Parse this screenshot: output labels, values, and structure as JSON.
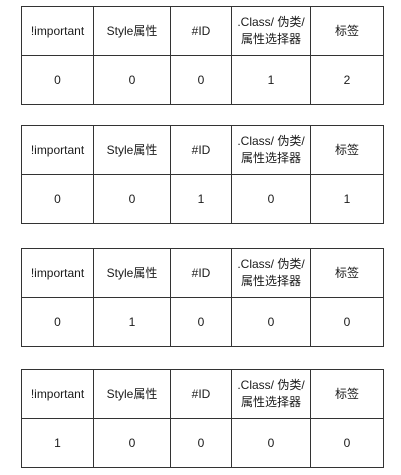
{
  "headers": {
    "important": "!important",
    "style": "Style属性",
    "id": "#ID",
    "class_line1": ".Class/ 伪类/",
    "class_line2": "属性选择器",
    "tag": "标签"
  },
  "tables": [
    {
      "values": [
        "0",
        "0",
        "0",
        "1",
        "2"
      ]
    },
    {
      "values": [
        "0",
        "0",
        "1",
        "0",
        "1"
      ]
    },
    {
      "values": [
        "0",
        "1",
        "0",
        "0",
        "0"
      ]
    },
    {
      "values": [
        "1",
        "0",
        "0",
        "0",
        "0"
      ]
    }
  ]
}
